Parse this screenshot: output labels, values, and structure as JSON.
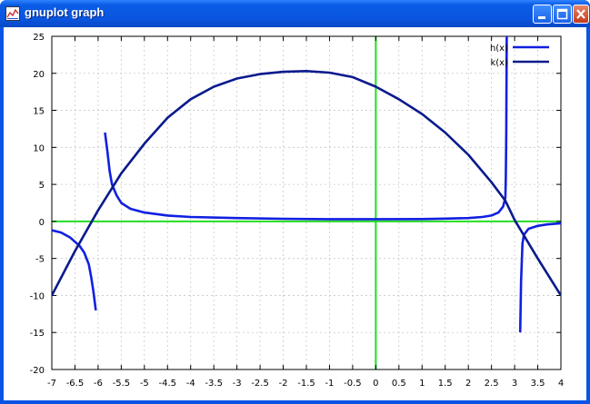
{
  "window": {
    "title": "gnuplot graph",
    "icon": "gnuplot-app-icon",
    "buttons": [
      "minimize-icon",
      "maximize-icon",
      "close-icon"
    ]
  },
  "chart_data": {
    "type": "line",
    "xlim": [
      -7,
      4
    ],
    "ylim": [
      -20,
      25
    ],
    "xticks": [
      -7,
      -6.5,
      -6,
      -5.5,
      -5,
      -4.5,
      -4,
      -3.5,
      -3,
      -2.5,
      -2,
      -1.5,
      -1,
      -0.5,
      0,
      0.5,
      1,
      1.5,
      2,
      2.5,
      3,
      3.5,
      4
    ],
    "yticks": [
      -20,
      -15,
      -10,
      -5,
      0,
      5,
      10,
      15,
      20,
      25
    ],
    "grid": true,
    "legend": "top-right",
    "axis_line_color": "#22dd22",
    "series": [
      {
        "name": "h(x)",
        "color": "#1020e0",
        "segments": [
          [
            [
              -7,
              -1.2
            ],
            [
              -6.8,
              -1.5
            ],
            [
              -6.6,
              -2.2
            ],
            [
              -6.4,
              -3.3
            ],
            [
              -6.3,
              -4.2
            ],
            [
              -6.2,
              -5.8
            ],
            [
              -6.15,
              -7.5
            ],
            [
              -6.1,
              -9.5
            ],
            [
              -6.05,
              -12
            ]
          ],
          [
            [
              -5.85,
              12
            ],
            [
              -5.8,
              9.5
            ],
            [
              -5.75,
              6.8
            ],
            [
              -5.7,
              5
            ],
            [
              -5.6,
              3.5
            ],
            [
              -5.5,
              2.5
            ],
            [
              -5.3,
              1.7
            ],
            [
              -5,
              1.2
            ],
            [
              -4.5,
              0.8
            ],
            [
              -4,
              0.6
            ],
            [
              -3,
              0.45
            ],
            [
              -2,
              0.35
            ],
            [
              -1,
              0.3
            ],
            [
              0,
              0.3
            ],
            [
              1,
              0.32
            ],
            [
              1.5,
              0.38
            ],
            [
              2,
              0.45
            ],
            [
              2.3,
              0.6
            ],
            [
              2.5,
              0.8
            ],
            [
              2.65,
              1.2
            ],
            [
              2.75,
              2
            ],
            [
              2.8,
              3.2
            ],
            [
              2.81,
              6
            ],
            [
              2.82,
              12
            ],
            [
              2.83,
              25
            ]
          ],
          [
            [
              3.12,
              -15
            ],
            [
              3.14,
              -8
            ],
            [
              3.17,
              -3
            ],
            [
              3.2,
              -1.8
            ],
            [
              3.3,
              -1
            ],
            [
              3.5,
              -0.6
            ],
            [
              3.7,
              -0.4
            ],
            [
              4,
              -0.25
            ]
          ]
        ]
      },
      {
        "name": "k(x)",
        "color": "#0a1a8c",
        "segments": [
          [
            [
              -7,
              -10
            ],
            [
              -6.5,
              -4
            ],
            [
              -6,
              1.5
            ],
            [
              -5.5,
              6.5
            ],
            [
              -5,
              10.5
            ],
            [
              -4.5,
              14
            ],
            [
              -4,
              16.5
            ],
            [
              -3.5,
              18.2
            ],
            [
              -3,
              19.3
            ],
            [
              -2.5,
              19.9
            ],
            [
              -2,
              20.2
            ],
            [
              -1.5,
              20.3
            ],
            [
              -1,
              20.1
            ],
            [
              -0.5,
              19.5
            ],
            [
              0,
              18.2
            ],
            [
              0.5,
              16.5
            ],
            [
              1,
              14.5
            ],
            [
              1.5,
              12
            ],
            [
              2,
              9
            ],
            [
              2.5,
              5.3
            ],
            [
              2.8,
              2.8
            ],
            [
              3,
              0.2
            ],
            [
              3.5,
              -5
            ],
            [
              4,
              -10
            ]
          ]
        ]
      }
    ]
  }
}
